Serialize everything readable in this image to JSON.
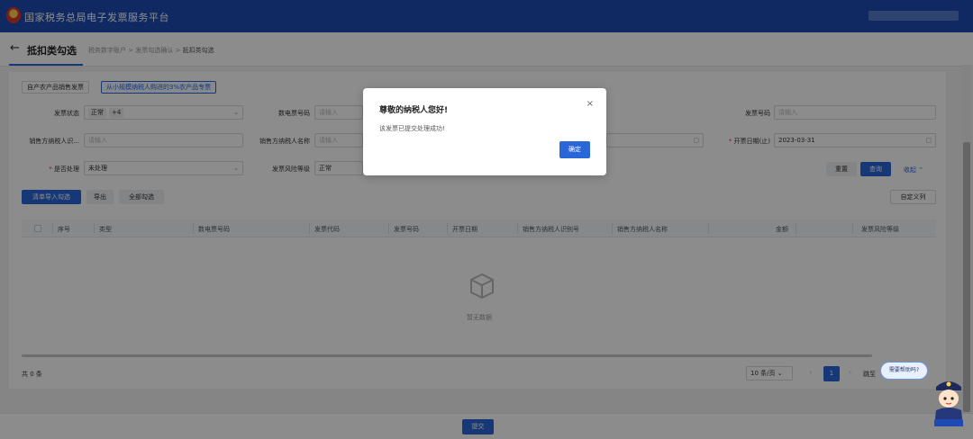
{
  "header": {
    "app_title": "国家税务总局电子发票服务平台"
  },
  "subheader": {
    "page_title": "抵扣类勾选",
    "breadcrumb": [
      "税务数字账户",
      "发票勾选确认",
      "抵扣类勾选"
    ]
  },
  "tabs": [
    "自产农产品销售发票",
    "从小规模纳税人购进的3%农产品专票"
  ],
  "filters": {
    "status": {
      "label": "发票状态",
      "tag1": "正常",
      "tag2": "+4"
    },
    "digital_no": {
      "label": "数电票号码",
      "placeholder": "请输入"
    },
    "invoice_no": {
      "label": "发票号码",
      "placeholder": "请输入"
    },
    "seller_id": {
      "label": "销售方纳税人识...",
      "placeholder": "请输入"
    },
    "seller_name": {
      "label": "销售方纳税人名称",
      "placeholder": "请输入"
    },
    "date_start": {
      "label": "开票日期(止)",
      "value": "2023-03-31"
    },
    "processed": {
      "label": "是否处理",
      "value": "未处理"
    },
    "risk": {
      "label": "发票风险等级",
      "value": "正常"
    }
  },
  "actions": {
    "reset": "重置",
    "search": "查询",
    "collapse": "收起",
    "import": "清单导入勾选",
    "export": "导出",
    "select_all": "全部勾选",
    "custom_cols": "自定义列"
  },
  "table": {
    "columns": [
      "序号",
      "类型",
      "数电票号码",
      "发票代码",
      "发票号码",
      "开票日期",
      "销售方纳税人识别号",
      "销售方纳税人名称",
      "金额",
      "发票风险等级"
    ],
    "empty_text": "暂无数据"
  },
  "pagination": {
    "total": "共 0 条",
    "page_size": "10 条/页",
    "current": "1",
    "jump": "跳至"
  },
  "footer": {
    "submit": "提交"
  },
  "modal": {
    "title": "尊敬的纳税人您好!",
    "message": "该发票已提交处理成功!",
    "confirm": "确定"
  },
  "assistant": {
    "bubble": "需要帮助吗?"
  },
  "colors": {
    "primary": "#2b66d9",
    "header": "#1e4bb3",
    "required": "#e4393c"
  },
  "icons": [
    "logo-icon",
    "back-arrow-icon",
    "chevron-down-icon",
    "calendar-icon",
    "close-icon",
    "empty-box-icon",
    "assistant-avatar-icon"
  ]
}
